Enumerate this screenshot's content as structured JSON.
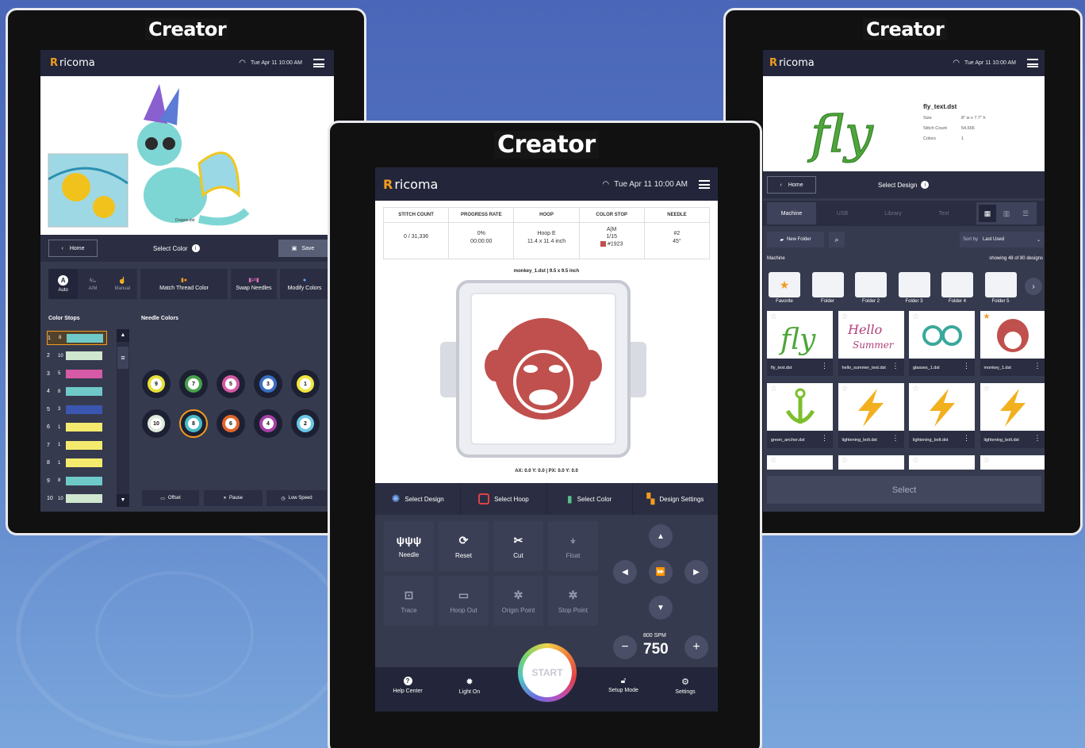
{
  "brand": "Creator",
  "logo_text": "ricoma",
  "status": {
    "wifi": "wifi-icon",
    "time": "Tue Apr 11  10:00 AM"
  },
  "left": {
    "file": "Dragon.dst",
    "home": "Home",
    "title": "Select Color",
    "save": "Save",
    "modes": [
      {
        "label": "Auto",
        "glyph": "A"
      },
      {
        "label": "A/M",
        "glyph": "A/M"
      },
      {
        "label": "Manual",
        "glyph": "☝"
      }
    ],
    "actions": [
      "Match Thread Color",
      "Swap Needles",
      "Modify Colors"
    ],
    "color_stops_title": "Color Stops",
    "needle_colors_title": "Needle Colors",
    "stops": [
      {
        "n": "1",
        "s": "8",
        "c": "#6fc9c8"
      },
      {
        "n": "2",
        "s": "10",
        "c": "#cfe7cf"
      },
      {
        "n": "3",
        "s": "5",
        "c": "#d75aa6"
      },
      {
        "n": "4",
        "s": "8",
        "c": "#6fc9c8"
      },
      {
        "n": "5",
        "s": "3",
        "c": "#3a56b0"
      },
      {
        "n": "6",
        "s": "1",
        "c": "#f4eb6e"
      },
      {
        "n": "7",
        "s": "1",
        "c": "#f4eb6e"
      },
      {
        "n": "8",
        "s": "1",
        "c": "#f4eb6e"
      },
      {
        "n": "9",
        "s": "8",
        "c": "#6fc9c8"
      },
      {
        "n": "10",
        "s": "10",
        "c": "#cfe7cf"
      }
    ],
    "needles_row1": [
      {
        "n": "9",
        "c": "#e8e03a"
      },
      {
        "n": "7",
        "c": "#47a24a"
      },
      {
        "n": "5",
        "c": "#d75aa6"
      },
      {
        "n": "3",
        "c": "#3a6fc0"
      },
      {
        "n": "1",
        "c": "#f0e640"
      }
    ],
    "needles_row2": [
      {
        "n": "10",
        "c": "#dfe9dc"
      },
      {
        "n": "8",
        "c": "#4bbbc4"
      },
      {
        "n": "6",
        "c": "#e0662a"
      },
      {
        "n": "4",
        "c": "#a541a7"
      },
      {
        "n": "2",
        "c": "#6cc7e6"
      }
    ],
    "bottom": [
      "Offset",
      "Pause",
      "Low Speed"
    ]
  },
  "center": {
    "headers": [
      "STITCH COUNT",
      "PROGRESS RATE",
      "HOOP",
      "COLOR STOP",
      "NEEDLE"
    ],
    "stitch": "0 / 31,336",
    "progress": [
      "0%",
      "00:00:00"
    ],
    "hoop": [
      "Hoop E",
      "11.4 x 11.4 inch"
    ],
    "color_stop": [
      "A|M",
      "1/15",
      "#1923"
    ],
    "needle": [
      "#2",
      "45°"
    ],
    "file_info": "monkey_1.dst  |  9.5 x 9.5 inch",
    "coords": "AX: 0.0  Y: 0.0  |  PX: 0.0  Y: 0.0",
    "tabs": [
      "Select Design",
      "Select Hoop",
      "Select Color",
      "Design Settings"
    ],
    "grid": [
      {
        "label": "Needle",
        "dim": false
      },
      {
        "label": "Reset",
        "dim": false
      },
      {
        "label": "Cut",
        "dim": false
      },
      {
        "label": "Float",
        "dim": true
      },
      {
        "label": "Trace",
        "dim": true
      },
      {
        "label": "Hoop Out",
        "dim": true
      },
      {
        "label": "Origin Point",
        "dim": true
      },
      {
        "label": "Stop Point",
        "dim": true
      }
    ],
    "spm_label": "800 SPM",
    "speed": "750",
    "start": "START",
    "bottom": [
      "Help Center",
      "Light On",
      "Setup Mode",
      "Settings"
    ]
  },
  "right": {
    "file_name": "fly_text.dst",
    "meta": [
      {
        "k": "Size",
        "v": "8\" w x 7.7\" h"
      },
      {
        "k": "Stitch Count",
        "v": "54,665"
      },
      {
        "k": "Colors",
        "v": "1"
      }
    ],
    "home": "Home",
    "title": "Select Design",
    "tabs": [
      "Machine",
      "USB",
      "Library",
      "Text"
    ],
    "new_folder": "New Folder",
    "sort_by": "Sort by",
    "sort_val": "Last Used",
    "location": "Machine",
    "showing": "showing 48 of 80 designs",
    "folders": [
      "Favorite",
      "Folder",
      "Folder 2",
      "Folder 3",
      "Folder 4",
      "Folder 5"
    ],
    "designs": [
      "fly_text.dst",
      "hello_summer_text.dst",
      "glasses_1.dst",
      "monkey_1.dst",
      "green_anchor.dst",
      "lightening_bolt.dst",
      "lightening_bolt.dst",
      "lightening_bolt.dst"
    ],
    "select": "Select"
  }
}
